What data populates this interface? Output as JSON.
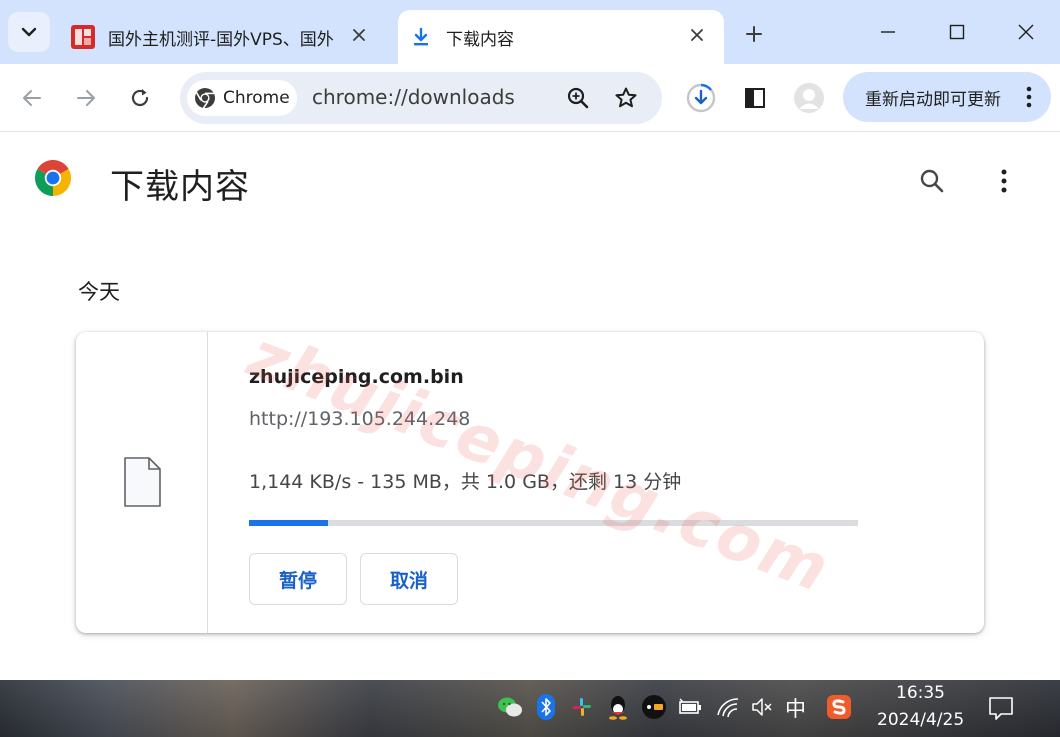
{
  "tabs": [
    {
      "title": "国外主机测评-国外VPS、国外",
      "active": false
    },
    {
      "title": "下载内容",
      "active": true
    }
  ],
  "omnibox": {
    "chip_label": "Chrome",
    "url": "chrome://downloads"
  },
  "toolbar": {
    "update_label": "重新启动即可更新"
  },
  "page": {
    "title": "下载内容",
    "date_heading": "今天"
  },
  "download": {
    "filename": "zhujiceping.com.bin",
    "source_url": "http://193.105.244.248",
    "status": "1,144 KB/s - 135 MB，共 1.0 GB，还剩 13 分钟",
    "progress_fraction": 0.13,
    "pause_label": "暂停",
    "cancel_label": "取消"
  },
  "watermark": "zhujiceping.com",
  "taskbar": {
    "ime": "中",
    "time": "16:35",
    "date": "2024/4/25"
  },
  "colors": {
    "tabstrip_bg": "#d3e3fd",
    "accent_blue": "#1a73e8",
    "button_text": "#1a62c8"
  }
}
